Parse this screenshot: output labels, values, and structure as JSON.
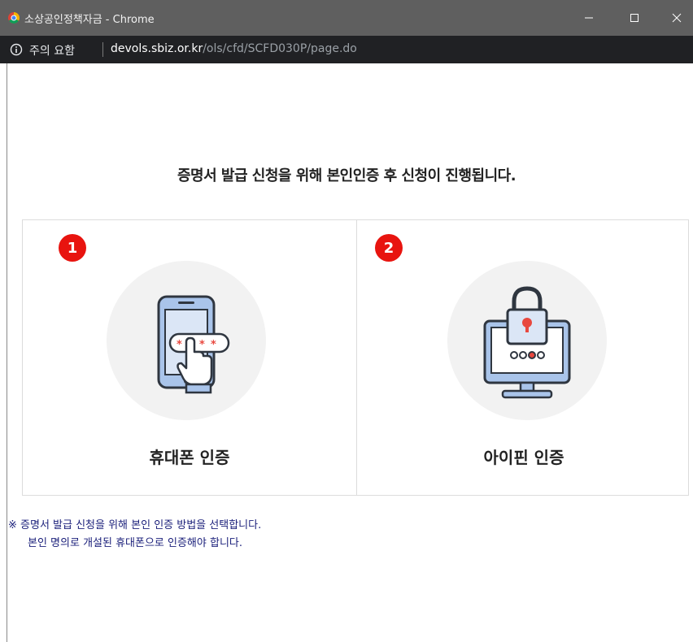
{
  "window": {
    "title": "소상공인정책자금 - Chrome",
    "controls": [
      "minimize-icon",
      "maximize-icon",
      "close-icon"
    ]
  },
  "address_bar": {
    "security_warning": "주의 요함",
    "url_host": "devols.sbiz.or.kr",
    "url_path": "/ols/cfd/SCFD030P/page.do"
  },
  "page": {
    "headline": "증명서 발급 신청을 위해 본인인증 후 신청이 진행됩니다.",
    "options": [
      {
        "badge": "1",
        "label": "휴대폰 인증",
        "icon": "phone-password-icon"
      },
      {
        "badge": "2",
        "label": "아이핀 인증",
        "icon": "monitor-lock-icon"
      }
    ],
    "notes": {
      "line1": "※  증명서 발급 신청을 위해 본인 인증 방법을 선택합니다.",
      "line2": "본인 명의로 개설된 휴대폰으로 인증해야 합니다."
    }
  },
  "colors": {
    "badge": "#e8140f",
    "titlebar": "#5f5f5f",
    "addressbar": "#202124",
    "note_text": "#1a1f7a",
    "icon_accent": "#e8483f",
    "icon_blue": "#a9c4ea"
  }
}
